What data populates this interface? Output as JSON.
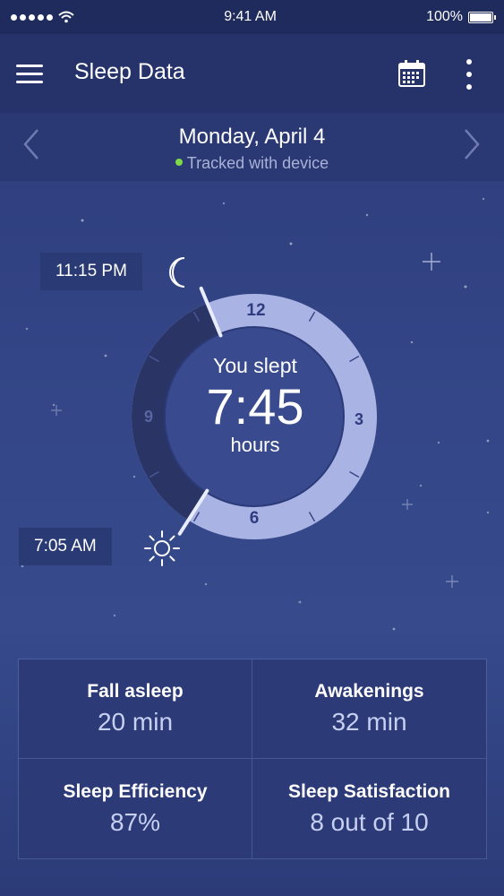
{
  "status_bar": {
    "time": "9:41 AM",
    "battery": "100%",
    "battery_level": 1.0
  },
  "app_bar": {
    "title": "Sleep Data"
  },
  "date_nav": {
    "date": "Monday, April 4",
    "tracked": "Tracked with device"
  },
  "dial": {
    "bedtime": "11:15 PM",
    "wake_time": "7:05 AM",
    "you_slept_label": "You slept",
    "duration": "7:45",
    "unit": "hours",
    "hour_labels": {
      "12": "12",
      "3": "3",
      "6": "6",
      "9": "9"
    }
  },
  "stats": [
    {
      "label": "Fall asleep",
      "value": "20 min"
    },
    {
      "label": "Awakenings",
      "value": "32 min"
    },
    {
      "label": "Sleep Efficiency",
      "value": "87%"
    },
    {
      "label": "Sleep Satisfaction",
      "value": "8 out of 10"
    }
  ],
  "colors": {
    "background": "#334586",
    "app_bar": "#26336b",
    "status_bar": "#1f2b5c",
    "dial_light": "#a9b3e4",
    "dial_dark": "#2a3566",
    "tracked_dot": "#7ed84a"
  }
}
